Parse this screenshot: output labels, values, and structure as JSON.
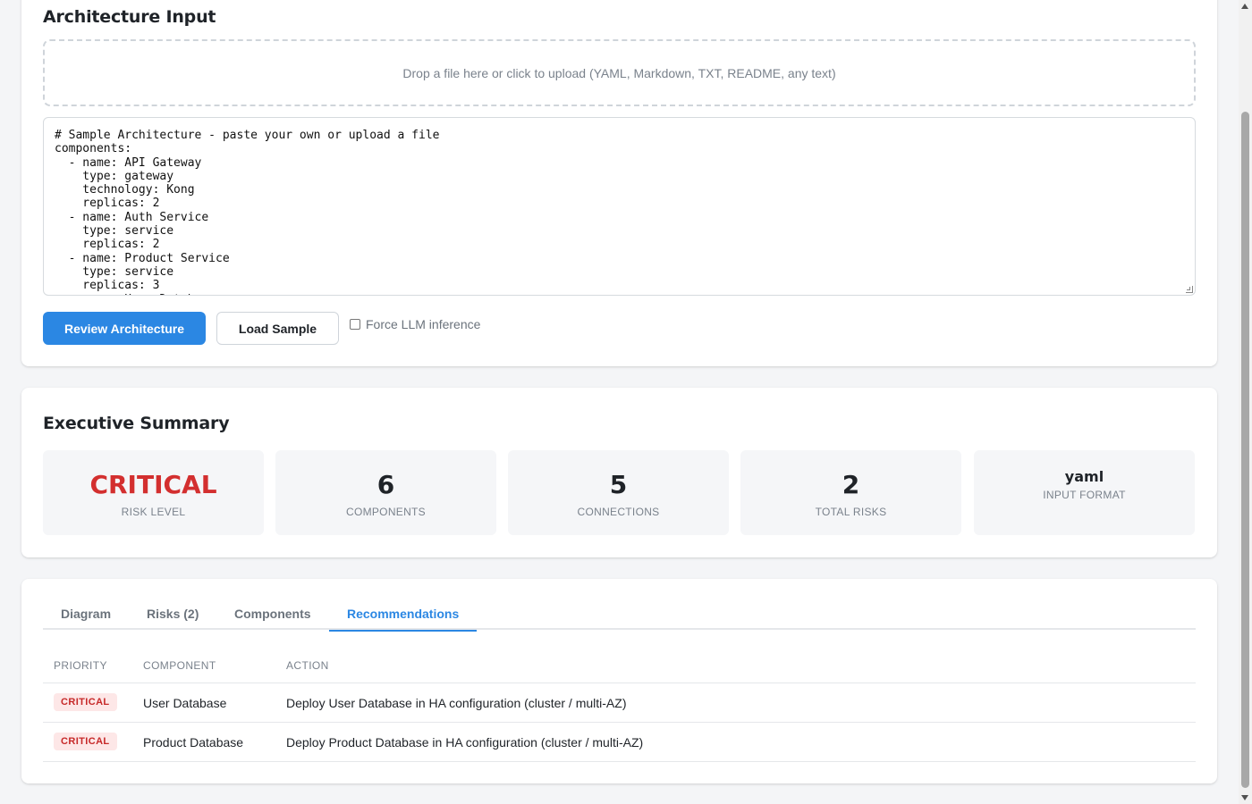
{
  "architecture_input": {
    "title": "Architecture Input",
    "dropzone_text": "Drop a file here or click to upload (YAML, Markdown, TXT, README, any text)",
    "code": "# Sample Architecture - paste your own or upload a file\ncomponents:\n  - name: API Gateway\n    type: gateway\n    technology: Kong\n    replicas: 2\n  - name: Auth Service\n    type: service\n    replicas: 2\n  - name: Product Service\n    type: service\n    replicas: 3\n  - name: User Database",
    "review_button": "Review Architecture",
    "load_sample_button": "Load Sample",
    "force_llm_label": "Force LLM inference",
    "force_llm_checked": false
  },
  "executive_summary": {
    "title": "Executive Summary",
    "risk_level": {
      "value": "CRITICAL",
      "label": "RISK LEVEL",
      "color": "#d32f2f"
    },
    "components": {
      "value": "6",
      "label": "COMPONENTS"
    },
    "connections": {
      "value": "5",
      "label": "CONNECTIONS"
    },
    "total_risks": {
      "value": "2",
      "label": "TOTAL RISKS"
    },
    "input_format": {
      "value": "yaml",
      "label": "INPUT FORMAT"
    }
  },
  "tabs": {
    "items": [
      {
        "label": "Diagram"
      },
      {
        "label": "Risks (2)"
      },
      {
        "label": "Components"
      },
      {
        "label": "Recommendations",
        "active": true
      }
    ],
    "accent_color": "#2b87e3"
  },
  "recommendations": {
    "headers": {
      "priority": "PRIORITY",
      "component": "COMPONENT",
      "action": "ACTION"
    },
    "rows": [
      {
        "priority": "CRITICAL",
        "component": "User Database",
        "action": "Deploy User Database in HA configuration (cluster / multi-AZ)"
      },
      {
        "priority": "CRITICAL",
        "component": "Product Database",
        "action": "Deploy Product Database in HA configuration (cluster / multi-AZ)"
      }
    ]
  }
}
